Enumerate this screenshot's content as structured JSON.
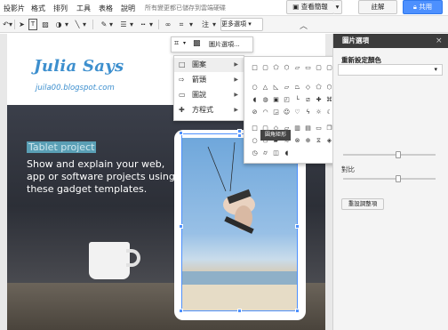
{
  "menubar": {
    "items": [
      "投影片",
      "格式",
      "排列",
      "工具",
      "表格",
      "說明"
    ],
    "save_status": "所有變更都已儲存到雲端硬碟",
    "present_label": "查看簡報",
    "comments_label": "註解",
    "share_label": "共用"
  },
  "toolbar": {
    "comment_label": "注",
    "more_options_label": "更多選項"
  },
  "crop_bar": {
    "image_options_label": "圖片選項..."
  },
  "crop_menu": {
    "items": [
      {
        "label": "圖案",
        "icon": "square-icon"
      },
      {
        "label": "箭頭",
        "icon": "arrow-icon"
      },
      {
        "label": "圖說",
        "icon": "callout-icon"
      },
      {
        "label": "方程式",
        "icon": "plus-icon"
      }
    ]
  },
  "tooltip": {
    "text": "圓角矩形"
  },
  "slide": {
    "title": "Julia Says",
    "url": "juila00.blogspot.com",
    "tablet_label": "Tablet project",
    "body": "Show and explain your web, app or software projects using these gadget templates."
  },
  "side_panel": {
    "title": "圖片選項",
    "recolor_label": "重新設定顏色",
    "contrast_label": "對比",
    "reset_label": "重設調整項"
  },
  "colors": {
    "accent_blue": "#4d90fe",
    "title_blue": "#3d8fce",
    "panel_header": "#3c3c3c"
  }
}
